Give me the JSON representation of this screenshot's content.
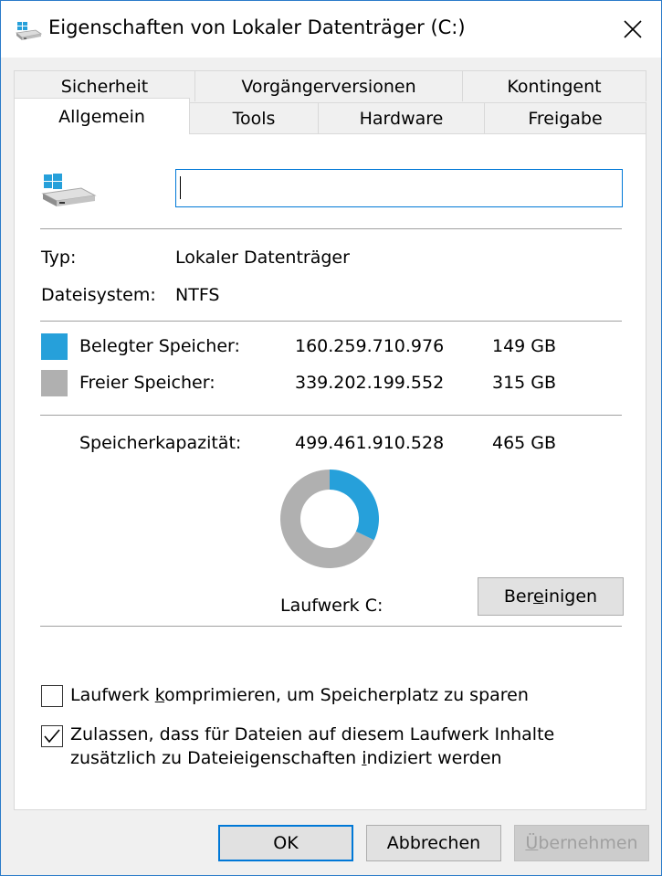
{
  "window": {
    "title": "Eigenschaften von Lokaler Datenträger (C:)"
  },
  "tabs": {
    "row_back": [
      "Sicherheit",
      "Vorgängerversionen",
      "Kontingent"
    ],
    "row_front": [
      "Allgemein",
      "Tools",
      "Hardware",
      "Freigabe"
    ],
    "active": "Allgemein"
  },
  "general": {
    "name_value": "",
    "type_label": "Typ:",
    "type_value": "Lokaler Datenträger",
    "fs_label": "Dateisystem:",
    "fs_value": "NTFS",
    "used_label": "Belegter Speicher:",
    "used_bytes": "160.259.710.976",
    "used_gb": "149 GB",
    "free_label": "Freier Speicher:",
    "free_bytes": "339.202.199.552",
    "free_gb": "315 GB",
    "capacity_label": "Speicherkapazität:",
    "capacity_bytes": "499.461.910.528",
    "capacity_gb": "465 GB",
    "drive_label": "Laufwerk C:",
    "cleanup_pre": "Ber",
    "cleanup_acc": "e",
    "cleanup_post": "inigen",
    "compress_pre": "Laufwerk ",
    "compress_acc": "k",
    "compress_post": "omprimieren, um Speicherplatz zu sparen",
    "compress_checked": false,
    "index_line1": "Zulassen, dass für Dateien auf diesem Laufwerk Inhalte",
    "index_line2_pre": "zusätzlich zu Dateieigenschaften ",
    "index_line2_acc": "i",
    "index_line2_post": "ndiziert werden",
    "index_checked": true
  },
  "usage": {
    "used_fraction": 0.321,
    "used_color": "#26a0da",
    "free_color": "#b0b0b0"
  },
  "footer": {
    "ok": "OK",
    "cancel": "Abbrechen",
    "apply_acc": "Ü",
    "apply_post": "bernehmen"
  },
  "icons": {
    "title": "drive-icon",
    "close": "close-icon",
    "drive": "windows-drive-icon",
    "check": "checkmark-icon"
  }
}
